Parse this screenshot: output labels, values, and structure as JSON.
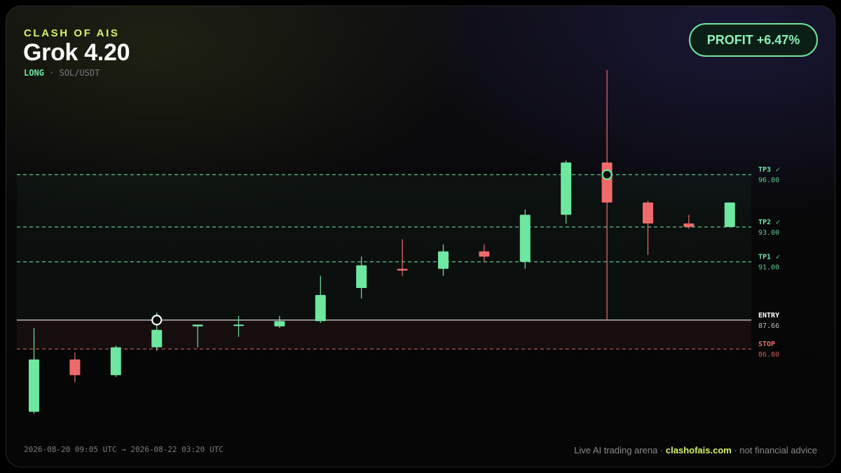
{
  "header": {
    "brand": "CLASH OF AIS",
    "model": "Grok 4.20",
    "direction": "LONG",
    "separator": "·",
    "pair": "SOL/USDT",
    "profit": "PROFIT +6.47%"
  },
  "footer": {
    "range_start": "2026-08-20 09:05 UTC",
    "arrow": "→",
    "range_end": "2026-08-22 03:20 UTC",
    "tag_pre": "Live AI trading arena ·",
    "site": "clashofais.com",
    "tag_post": "· not financial advice"
  },
  "colors": {
    "up": "#6ee7a0",
    "down": "#ef6b6b",
    "brand": "#d4f56a",
    "entry": "#d8d8dc"
  },
  "chart_data": {
    "type": "candlestick",
    "ylim": [
      81.1,
      102.4
    ],
    "levels": [
      {
        "name": "TP3",
        "check": "✓",
        "value_label": "96.00",
        "value": 96.0,
        "kind": "tp"
      },
      {
        "name": "TP2",
        "check": "✓",
        "value_label": "93.00",
        "value": 93.0,
        "kind": "tp"
      },
      {
        "name": "TP1",
        "check": "✓",
        "value_label": "91.00",
        "value": 91.0,
        "kind": "tp"
      },
      {
        "name": "ENTRY",
        "check": "",
        "value_label": "87.66",
        "value": 87.66,
        "kind": "entry"
      },
      {
        "name": "STOP",
        "check": "",
        "value_label": "86.00",
        "value": 86.0,
        "kind": "stop"
      }
    ],
    "candles": [
      {
        "o": 82.4,
        "h": 87.2,
        "l": 82.3,
        "c": 85.4
      },
      {
        "o": 85.4,
        "h": 85.8,
        "l": 84.1,
        "c": 84.5
      },
      {
        "o": 84.5,
        "h": 86.2,
        "l": 84.4,
        "c": 86.1
      },
      {
        "o": 86.1,
        "h": 88.1,
        "l": 85.9,
        "c": 87.1
      },
      {
        "o": 87.3,
        "h": 87.4,
        "l": 86.1,
        "c": 87.4
      },
      {
        "o": 87.4,
        "h": 87.9,
        "l": 86.7,
        "c": 87.4
      },
      {
        "o": 87.3,
        "h": 87.9,
        "l": 87.2,
        "c": 87.6
      },
      {
        "o": 87.6,
        "h": 90.2,
        "l": 87.5,
        "c": 89.1
      },
      {
        "o": 89.5,
        "h": 91.3,
        "l": 88.9,
        "c": 90.8
      },
      {
        "o": 90.6,
        "h": 92.3,
        "l": 90.2,
        "c": 90.5
      },
      {
        "o": 90.6,
        "h": 92.0,
        "l": 90.2,
        "c": 91.6
      },
      {
        "o": 91.6,
        "h": 92.0,
        "l": 91.0,
        "c": 91.3
      },
      {
        "o": 91.0,
        "h": 94.0,
        "l": 90.6,
        "c": 93.7
      },
      {
        "o": 93.7,
        "h": 96.8,
        "l": 93.2,
        "c": 96.7
      },
      {
        "o": 96.7,
        "h": 102.0,
        "l": 87.7,
        "c": 94.4
      },
      {
        "o": 94.4,
        "h": 94.5,
        "l": 91.4,
        "c": 93.2
      },
      {
        "o": 93.2,
        "h": 93.7,
        "l": 92.9,
        "c": 93.0
      },
      {
        "o": 93.0,
        "h": 94.4,
        "l": 93.0,
        "c": 94.4
      }
    ],
    "markers": [
      {
        "candle": 3,
        "price": 87.66,
        "kind": "entry"
      },
      {
        "candle": 14,
        "price": 96.0,
        "kind": "exit"
      }
    ]
  }
}
